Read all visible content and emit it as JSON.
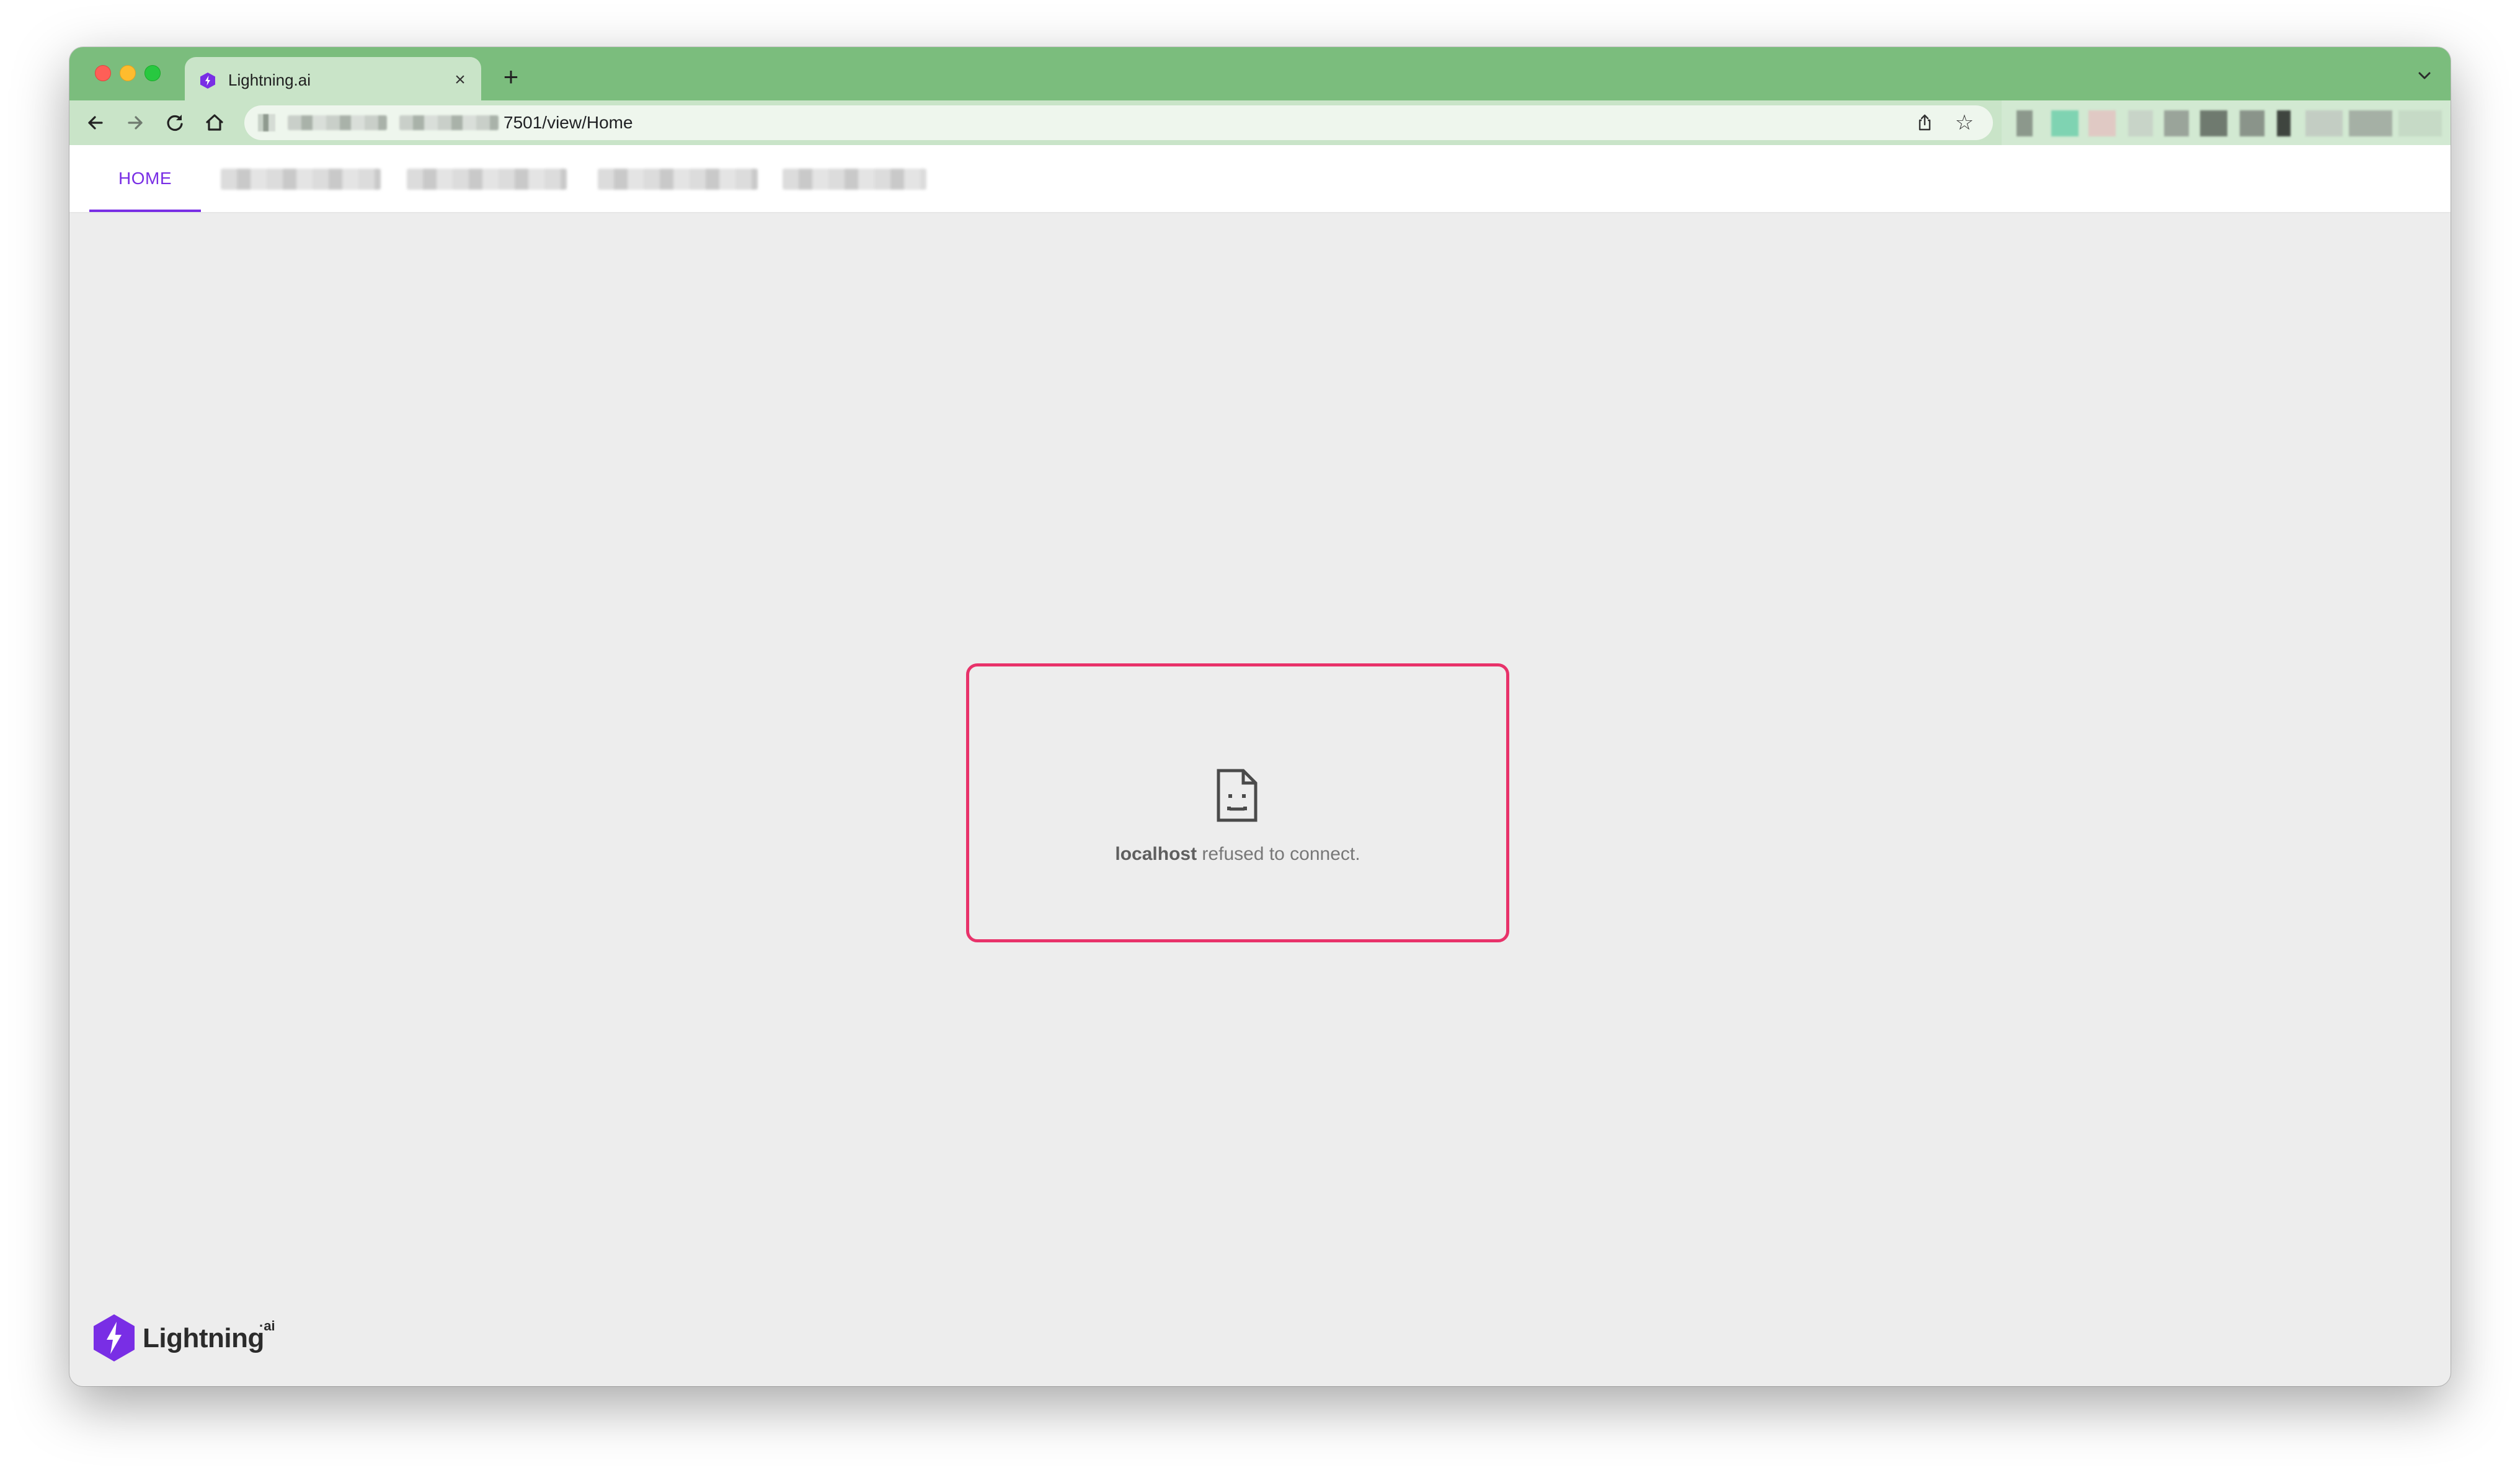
{
  "browser": {
    "tab": {
      "title": "Lightning.ai",
      "close_glyph": "×",
      "favicon": "lightning-hexagon-icon"
    },
    "new_tab_glyph": "+",
    "address_bar": {
      "url_visible_suffix": "7501/view/Home"
    },
    "toolbar_icons": [
      "back-arrow-icon",
      "forward-arrow-icon",
      "reload-icon",
      "home-icon",
      "share-icon",
      "star-icon"
    ],
    "star_glyph": "☆"
  },
  "app": {
    "nav": {
      "active_tab": "HOME"
    },
    "error": {
      "host": "localhost",
      "message": " refused to connect."
    },
    "logo": {
      "word": "Lightning",
      "suffix": "·ai"
    }
  },
  "colors": {
    "tabstrip": "#7bbd7d",
    "toolbar": "#c9e4c8",
    "accent_purple": "#792ee5",
    "error_outline": "#e8326a",
    "page_background": "#ededed"
  }
}
